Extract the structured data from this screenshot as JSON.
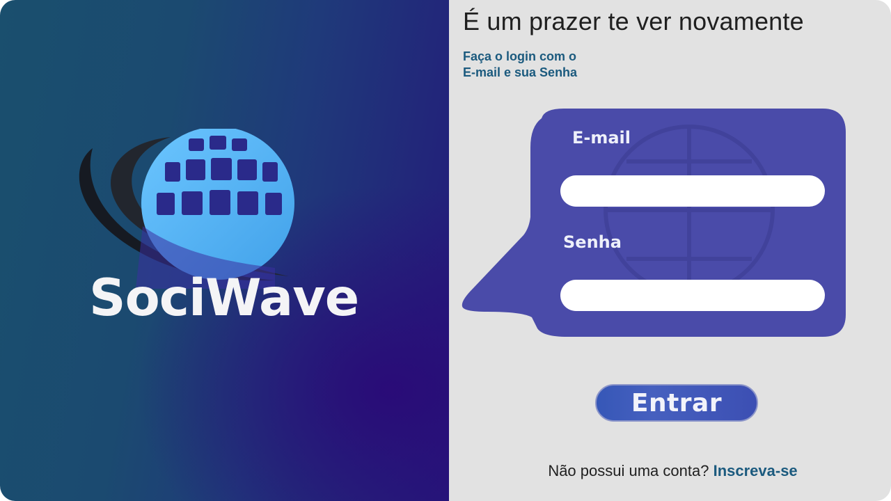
{
  "brand": {
    "name": "SociWave"
  },
  "login": {
    "welcome": "É um prazer te ver novamente",
    "subtitle_line1": "Faça o login com o",
    "subtitle_line2": "E-mail e sua Senha",
    "email_label": "E-mail",
    "email_value": "",
    "password_label": "Senha",
    "password_value": "",
    "submit_label": "Entrar",
    "no_account_text": "Não possui uma conta?",
    "signup_link": "Inscreva-se"
  },
  "icons": {
    "logo": "globe-wave-icon",
    "bubble": "speech-bubble-shape"
  },
  "colors": {
    "left_bg_start": "#1a4f6e",
    "left_bg_end": "#24197a",
    "right_bg": "#e2e2e2",
    "bubble": "#4a4ba9",
    "accent_text": "#1b5a7e",
    "button": "#3c55b6"
  }
}
